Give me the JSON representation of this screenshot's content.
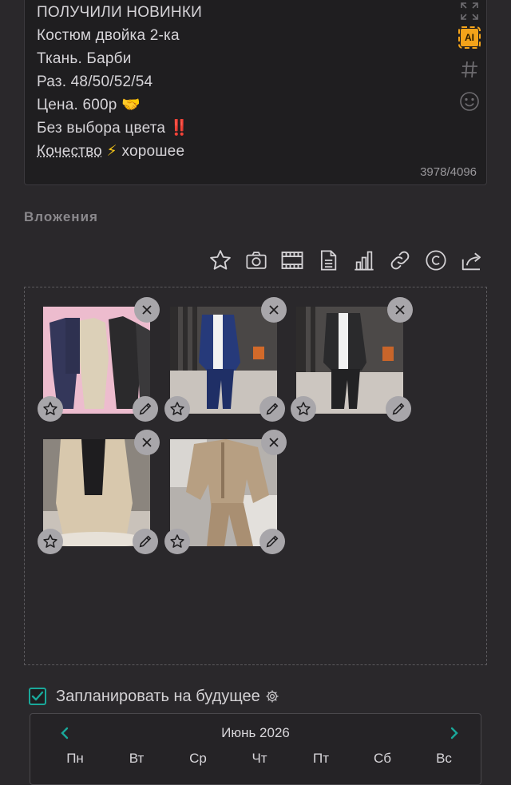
{
  "post": {
    "lines": [
      "ПОЛУЧИЛИ НОВИНКИ",
      "Костюм двойка 2-ка",
      "Ткань. Барби",
      "Раз. 48/50/52/54"
    ],
    "price_text": "Цена. 600р",
    "price_emoji": "🤝",
    "color_text": "Без выбора цвета",
    "color_emoji": "‼️",
    "quality_word": "Кочество",
    "quality_emoji": "⚡",
    "quality_rest": "хорошее",
    "char_count": "3978/4096"
  },
  "side_tools": {
    "ai_label": "AI",
    "icons": [
      "fullscreen-icon",
      "ai-icon",
      "hashtag-icon",
      "emoji-icon"
    ],
    "accent_color": "#f3a31a"
  },
  "attachments": {
    "section_title": "Вложения",
    "toolbar_icons": [
      "star-icon",
      "camera-icon",
      "film-icon",
      "document-icon",
      "chart-icon",
      "link-icon",
      "copyright-icon",
      "share-icon"
    ],
    "images": [
      {
        "name": "suit-navy-beige-black"
      },
      {
        "name": "suit-navy-model"
      },
      {
        "name": "suit-black-model"
      },
      {
        "name": "suit-beige-model"
      },
      {
        "name": "suit-beige-flatlay"
      }
    ]
  },
  "schedule": {
    "label": "Запланировать на будущее",
    "checked": true,
    "check_color": "#1aa89a"
  },
  "calendar": {
    "month_title": "Июнь 2026",
    "weekdays": [
      "Пн",
      "Вт",
      "Ср",
      "Чт",
      "Пт",
      "Сб",
      "Вс"
    ]
  }
}
